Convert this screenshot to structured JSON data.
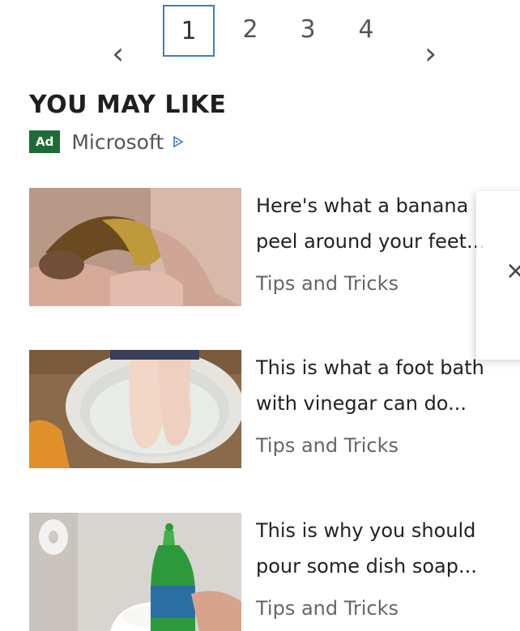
{
  "pagination": {
    "prev_icon": "chevron-left-icon",
    "next_icon": "chevron-right-icon",
    "prev_glyph": "‹",
    "next_glyph": "›",
    "pages": [
      "1",
      "2",
      "3",
      "4"
    ],
    "active_page": "1"
  },
  "section": {
    "title": "YOU MAY LIKE"
  },
  "ad": {
    "badge": "Ad",
    "sponsor": "Microsoft",
    "adchoices_icon": "adchoices-icon",
    "badge_color": "#1e6b35",
    "icon_color": "#3a7dc9"
  },
  "articles": [
    {
      "title": "Here's what a banana\npeel around your feet...",
      "source": "Tips and Tricks"
    },
    {
      "title": "This is what a foot bath\nwith vinegar can do...",
      "source": "Tips and Tricks"
    },
    {
      "title": "This is why you should\npour some dish soap...",
      "source": "Tips and Tricks"
    }
  ],
  "popup": {
    "close_glyph": "×",
    "close_icon": "close-icon"
  },
  "colors": {
    "accent": "#3a7dc9",
    "text": "#222222",
    "muted": "#666666"
  }
}
